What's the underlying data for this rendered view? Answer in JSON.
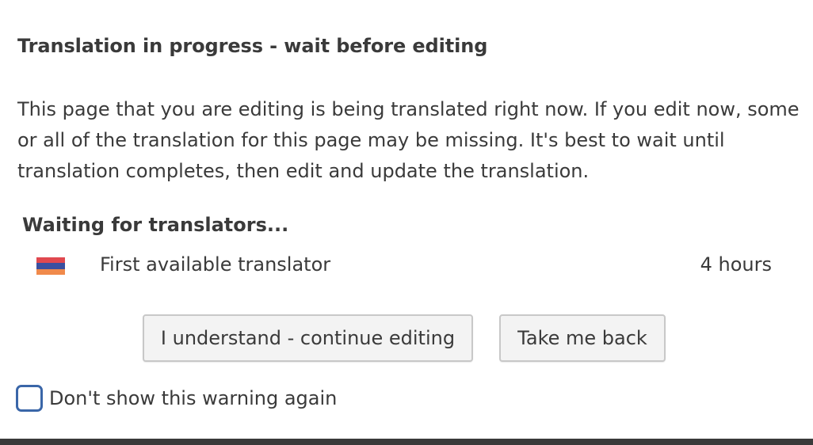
{
  "dialog": {
    "title": "Translation in progress - wait before editing",
    "message": "This page that you are editing is being translated right now. If you edit now, some or all of the translation for this page may be missing. It's best to wait until translation completes, then edit and update the translation.",
    "waiting_heading": "Waiting for translators...",
    "translators": [
      {
        "name": "First available translator",
        "time": "4 hours",
        "flag_icon": "armenia-flag-icon",
        "flag_colors": [
          "#e0484f",
          "#3a4fa0",
          "#f08a4b"
        ]
      }
    ],
    "buttons": {
      "continue_label": "I understand - continue editing",
      "back_label": "Take me back"
    },
    "checkbox": {
      "label": "Don't show this warning again",
      "checked": false
    }
  },
  "colors": {
    "text": "#3a3a3a",
    "checkbox_border": "#3a66a8",
    "button_bg": "#f3f3f3",
    "button_border": "#c8c8c8"
  }
}
